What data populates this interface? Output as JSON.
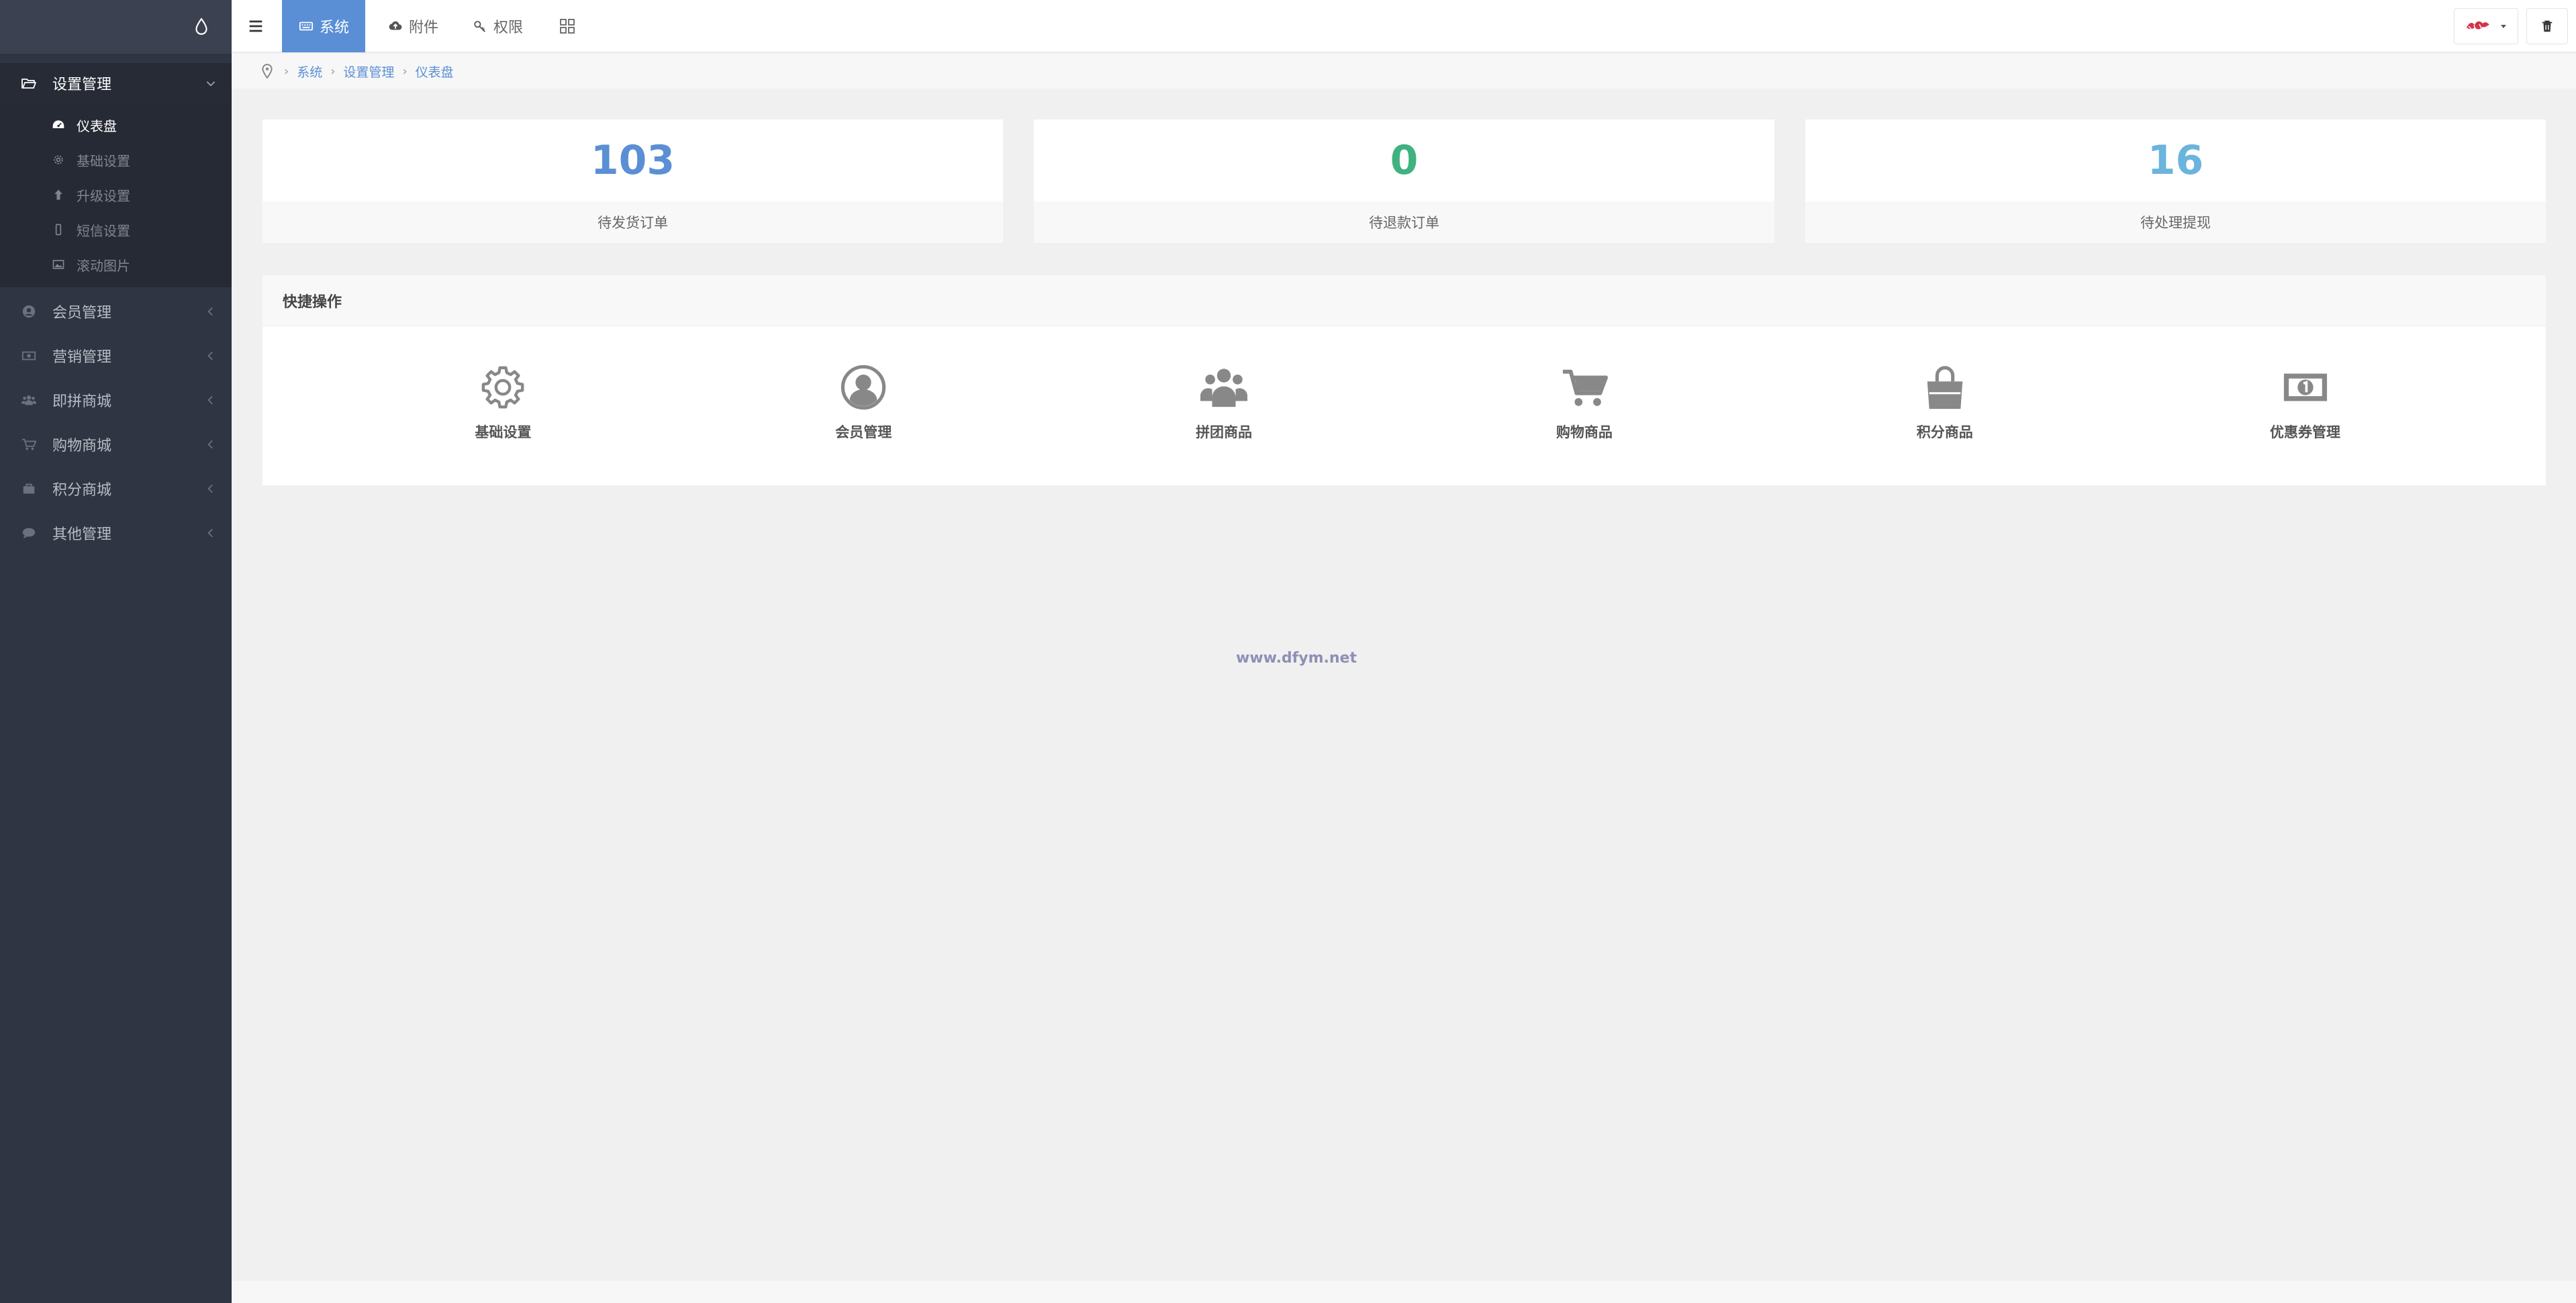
{
  "sidebar": {
    "groups": [
      {
        "label": "设置管理",
        "icon": "folder-open-icon",
        "expanded": true,
        "items": [
          {
            "label": "仪表盘",
            "icon": "dashboard-icon",
            "active": true
          },
          {
            "label": "基础设置",
            "icon": "gear-icon"
          },
          {
            "label": "升级设置",
            "icon": "arrow-up-icon"
          },
          {
            "label": "短信设置",
            "icon": "mobile-icon"
          },
          {
            "label": "滚动图片",
            "icon": "image-icon"
          }
        ]
      },
      {
        "label": "会员管理",
        "icon": "user-circle-icon"
      },
      {
        "label": "营销管理",
        "icon": "money-icon"
      },
      {
        "label": "即拼商城",
        "icon": "group-icon"
      },
      {
        "label": "购物商城",
        "icon": "cart-icon"
      },
      {
        "label": "积分商城",
        "icon": "briefcase-icon"
      },
      {
        "label": "其他管理",
        "icon": "comment-icon"
      }
    ]
  },
  "topbar": {
    "tabs": [
      {
        "label": "系统",
        "icon": "keyboard-icon",
        "active": true
      },
      {
        "label": "附件",
        "icon": "cloud-upload-icon"
      },
      {
        "label": "权限",
        "icon": "key-icon"
      }
    ]
  },
  "breadcrumb": [
    "系统",
    "设置管理",
    "仪表盘"
  ],
  "stats": [
    {
      "value": "103",
      "label": "待发货订单",
      "color": "#5b8fd4"
    },
    {
      "value": "0",
      "label": "待退款订单",
      "color": "#3fb27f"
    },
    {
      "value": "16",
      "label": "待处理提现",
      "color": "#6ab4dd"
    }
  ],
  "quick": {
    "title": "快捷操作",
    "items": [
      {
        "label": "基础设置",
        "icon": "gear-icon"
      },
      {
        "label": "会员管理",
        "icon": "user-circle-icon"
      },
      {
        "label": "拼团商品",
        "icon": "group-icon"
      },
      {
        "label": "购物商品",
        "icon": "cart-icon"
      },
      {
        "label": "积分商品",
        "icon": "shopping-bag-icon"
      },
      {
        "label": "优惠券管理",
        "icon": "money-icon"
      }
    ]
  },
  "watermark": "www.dfym.net",
  "colors": {
    "sidebar": "#2f3542",
    "accent": "#5a8fd6",
    "background": "#f0f0f0"
  }
}
